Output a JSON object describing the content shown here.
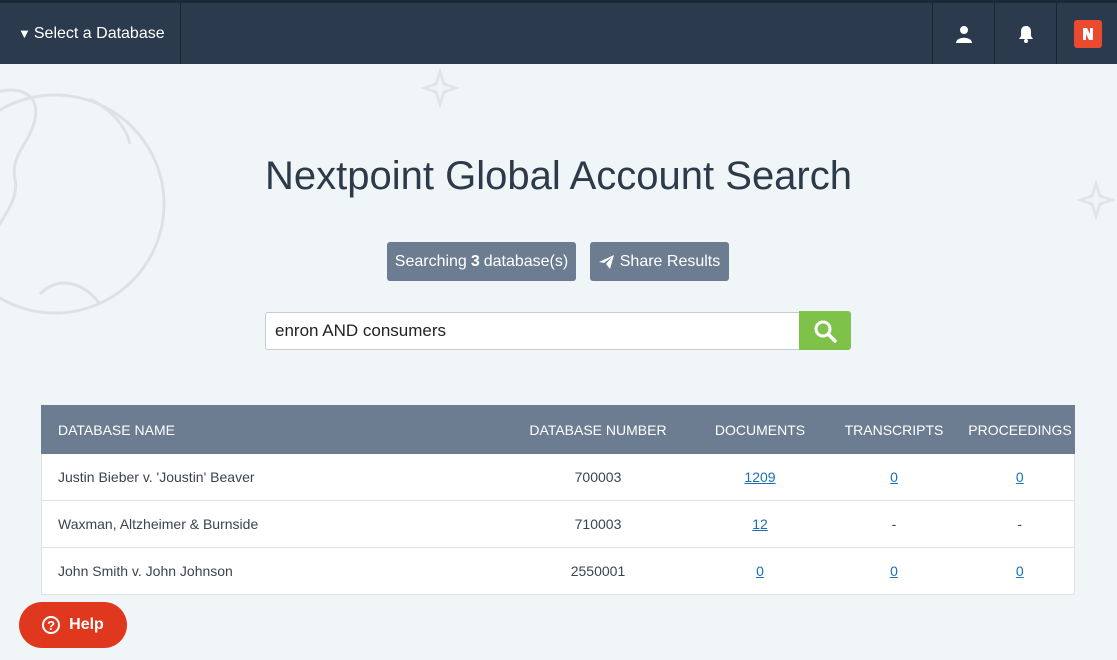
{
  "topbar": {
    "db_select_label": "Select a Database",
    "icons": [
      "user-icon",
      "bell-icon",
      "nextpoint-logo-icon"
    ]
  },
  "main": {
    "title": "Nextpoint Global Account Search",
    "searching_prefix": "Searching",
    "searching_count": "3",
    "searching_suffix": "database(s)",
    "share_label": "Share Results",
    "search_value": "enron AND consumers"
  },
  "table": {
    "headers": [
      "DATABASE NAME",
      "DATABASE NUMBER",
      "DOCUMENTS",
      "TRANSCRIPTS",
      "PROCEEDINGS"
    ],
    "rows": [
      {
        "name": "Justin Bieber v. 'Joustin' Beaver",
        "number": "700003",
        "documents": "1209",
        "transcripts": "0",
        "proceedings": "0"
      },
      {
        "name": "Waxman, Altzheimer & Burnside",
        "number": "710003",
        "documents": "12",
        "transcripts": "-",
        "proceedings": "-"
      },
      {
        "name": "John Smith v. John Johnson",
        "number": "2550001",
        "documents": "0",
        "transcripts": "0",
        "proceedings": "0"
      }
    ]
  },
  "help": {
    "label": "Help"
  },
  "colors": {
    "topbar": "#2b3a4c",
    "accent_green": "#7fc24a",
    "header_gray": "#6c7d91",
    "help_red": "#e0371f",
    "link_blue": "#1a6fb5"
  }
}
